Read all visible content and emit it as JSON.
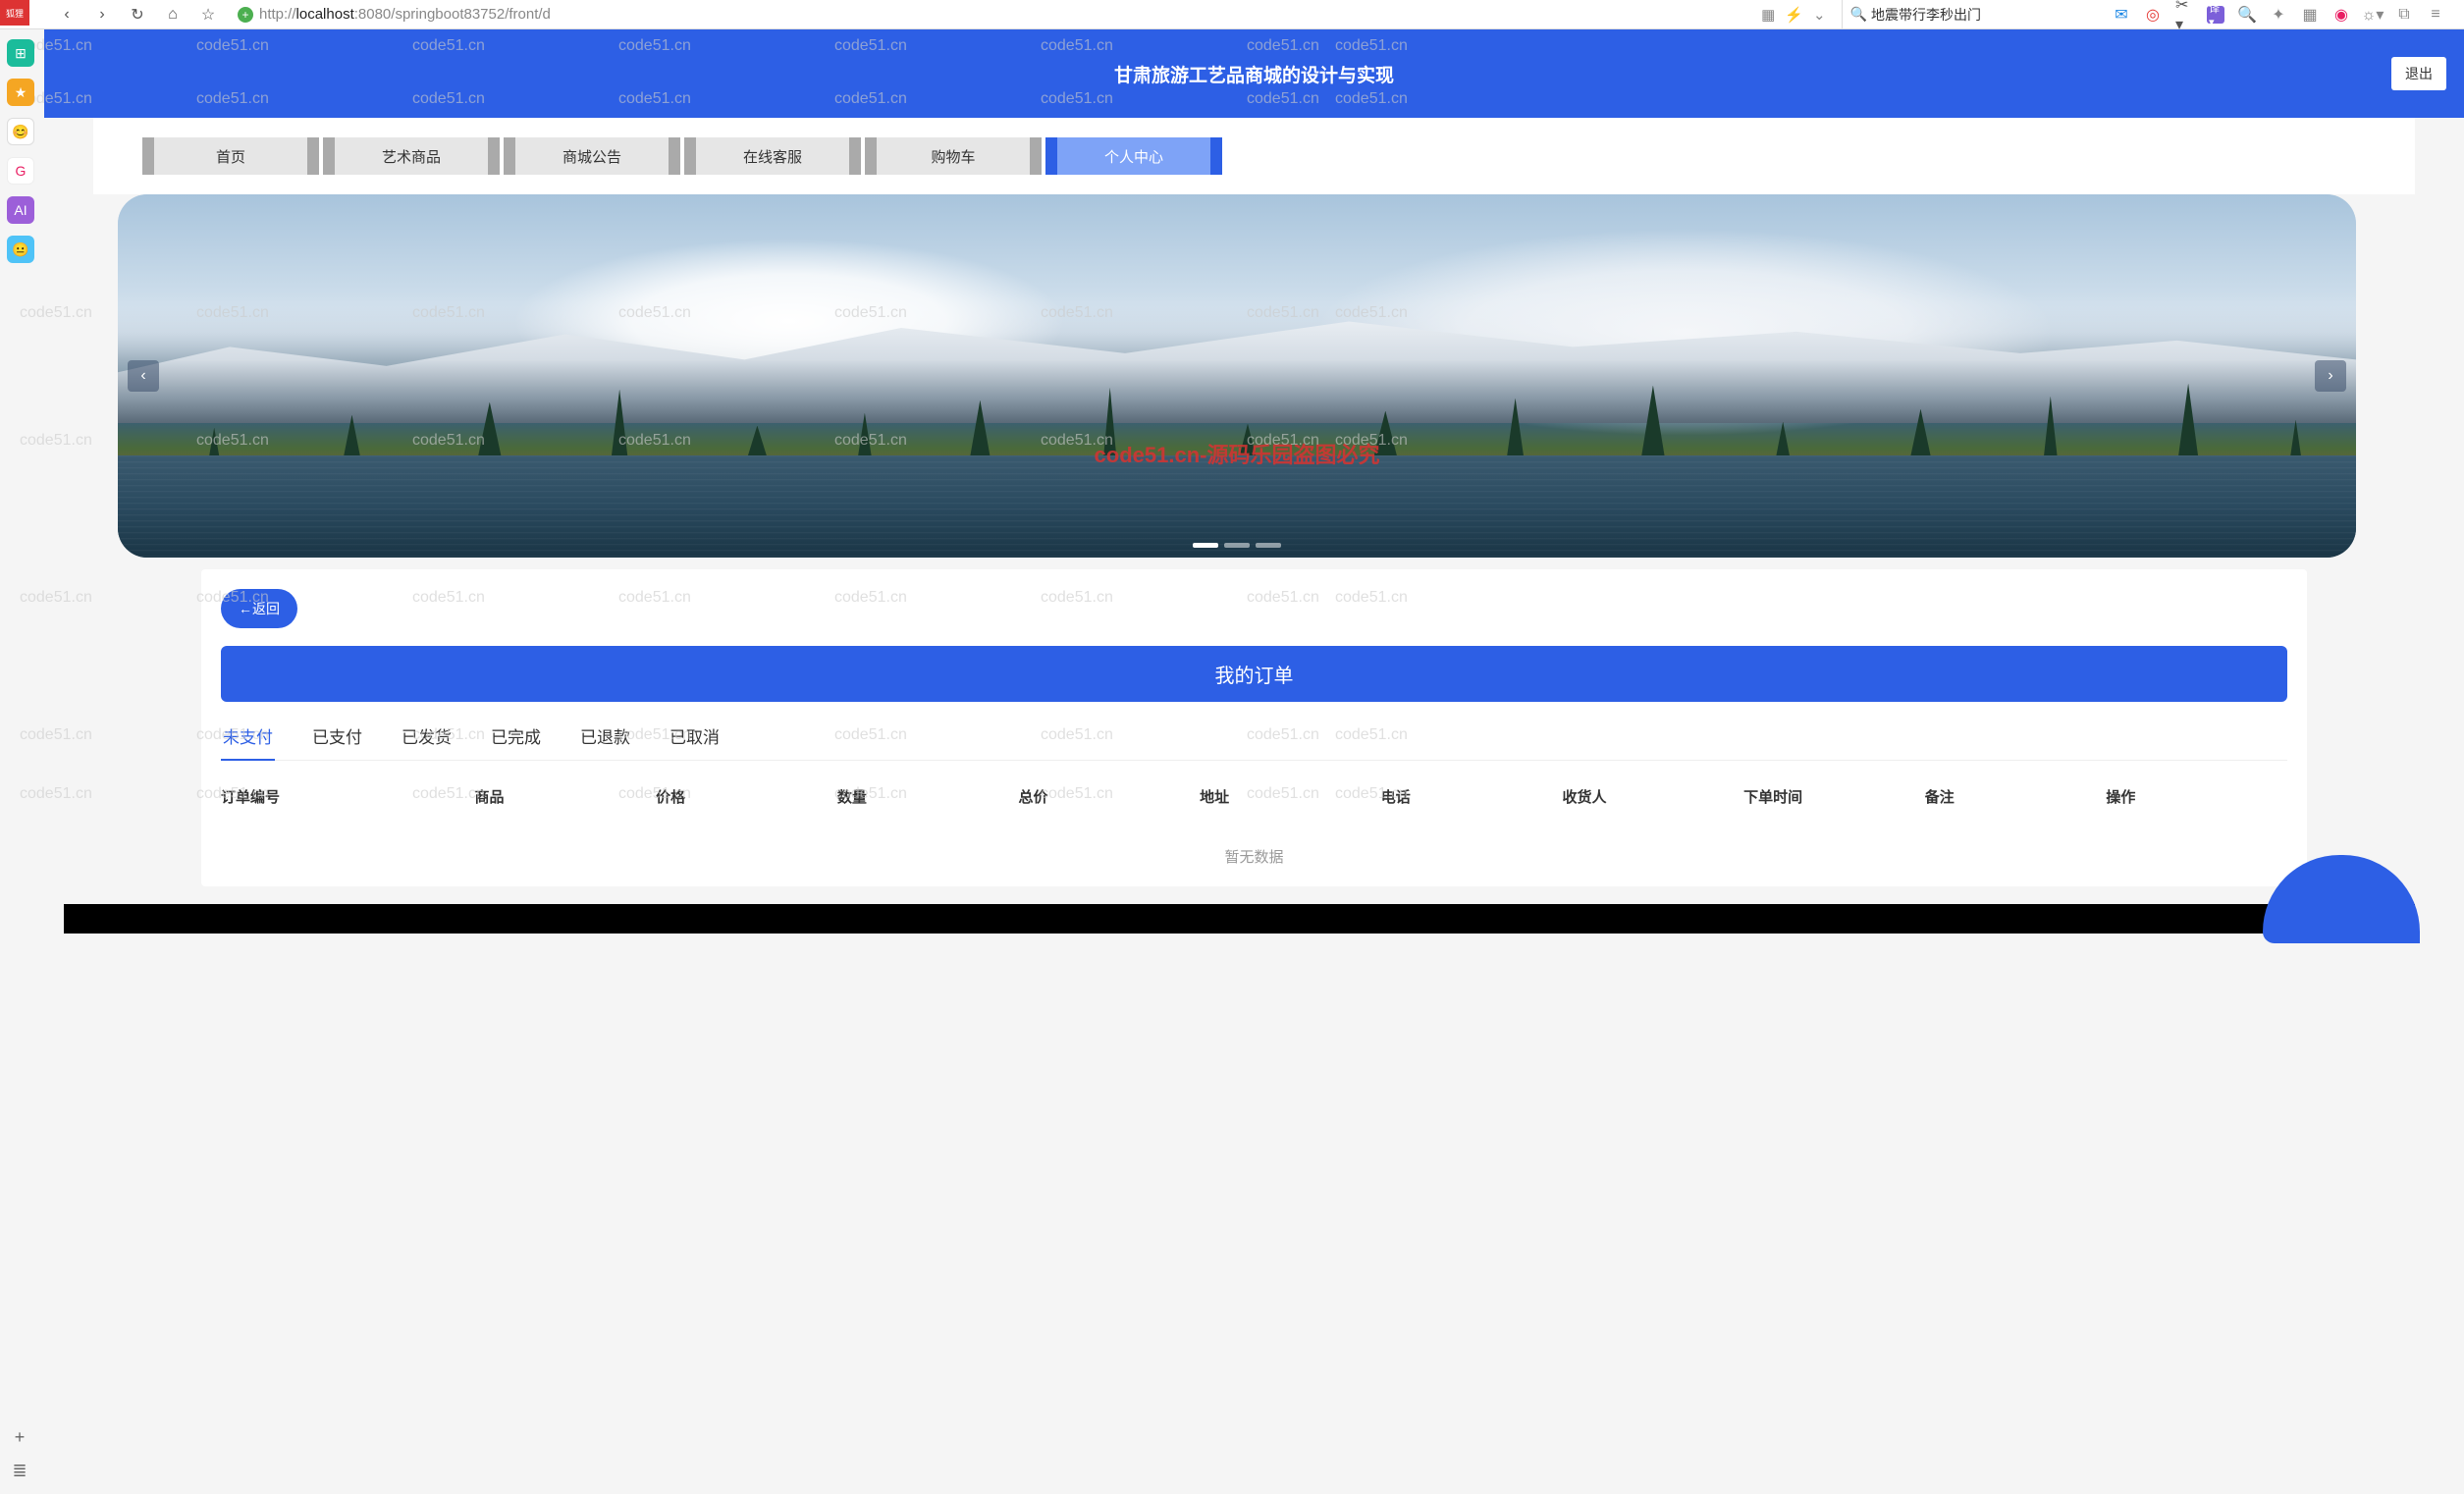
{
  "browser": {
    "url_prefix": "http://",
    "url_host": "localhost",
    "url_path": ":8080/springboot83752/front/d",
    "search_text": "地震带行李秒出门"
  },
  "header": {
    "title": "甘肃旅游工艺品商城的设计与实现",
    "username": "",
    "logout": "退出"
  },
  "nav": {
    "items": [
      {
        "label": "首页"
      },
      {
        "label": "艺术商品"
      },
      {
        "label": "商城公告"
      },
      {
        "label": "在线客服"
      },
      {
        "label": "购物车"
      },
      {
        "label": "个人中心",
        "active": true
      }
    ]
  },
  "banner": {
    "watermark": "code51.cn-源码乐园盗图必究"
  },
  "panel": {
    "back": "←返回",
    "title": "我的订单",
    "tabs": [
      "未支付",
      "已支付",
      "已发货",
      "已完成",
      "已退款",
      "已取消"
    ],
    "active_tab": 0,
    "columns": [
      "订单编号",
      "商品",
      "价格",
      "数量",
      "总价",
      "地址",
      "电话",
      "收货人",
      "下单时间",
      "备注",
      "操作"
    ],
    "empty": "暂无数据"
  },
  "watermark_text": "code51.cn"
}
